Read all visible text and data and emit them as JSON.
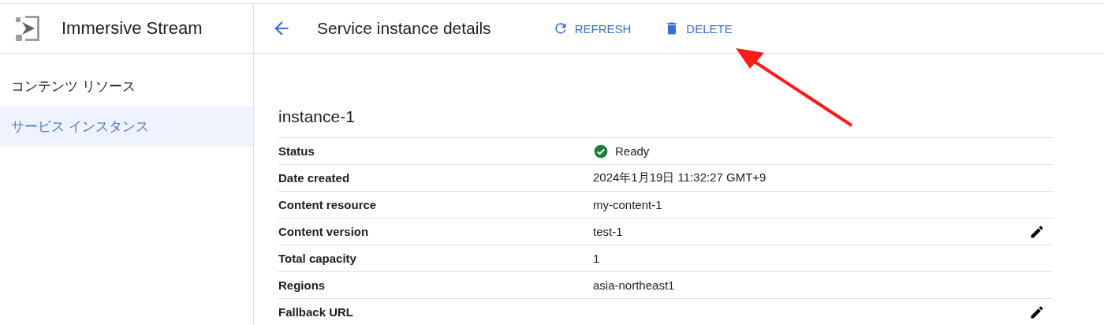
{
  "app": {
    "title": "Immersive Stream"
  },
  "sidebar": {
    "items": [
      {
        "label": "コンテンツ リソース",
        "selected": false
      },
      {
        "label": "サービス インスタンス",
        "selected": true
      }
    ]
  },
  "header": {
    "title": "Service instance details",
    "actions": [
      {
        "kind": "refresh",
        "label": "REFRESH"
      },
      {
        "kind": "delete",
        "label": "DELETE"
      }
    ]
  },
  "instance": {
    "name": "instance-1",
    "rows": [
      {
        "label": "Status",
        "value": "Ready",
        "kind": "status",
        "editable": false
      },
      {
        "label": "Date created",
        "value": "2024年1月19日 11:32:27 GMT+9",
        "kind": "text",
        "editable": false
      },
      {
        "label": "Content resource",
        "value": "my-content-1",
        "kind": "text",
        "editable": false
      },
      {
        "label": "Content version",
        "value": "test-1",
        "kind": "text",
        "editable": true
      },
      {
        "label": "Total capacity",
        "value": "1",
        "kind": "text",
        "editable": false
      },
      {
        "label": "Regions",
        "value": "asia-northeast1",
        "kind": "text",
        "editable": false
      },
      {
        "label": "Fallback URL",
        "kind": "text",
        "editable": true
      }
    ]
  },
  "annotation": {
    "kind": "arrow"
  }
}
